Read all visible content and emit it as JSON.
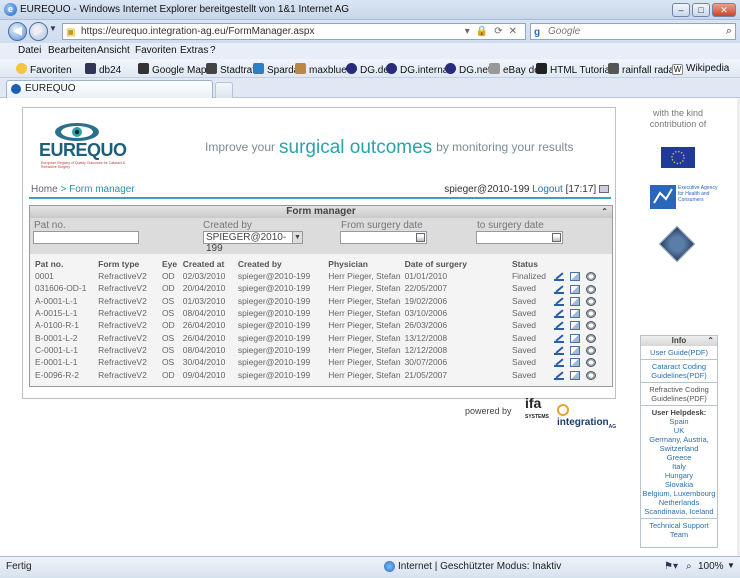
{
  "window": {
    "title": "EUREQUO - Windows Internet Explorer bereitgestellt von 1&1 Internet AG"
  },
  "address": {
    "url": "https://eurequo.integration-ag.eu/FormManager.aspx"
  },
  "search": {
    "placeholder": "Google"
  },
  "menu": [
    "Datei",
    "Bearbeiten",
    "Ansicht",
    "Favoriten",
    "Extras",
    "?"
  ],
  "favorites": {
    "label": "Favoriten",
    "items": [
      "db24",
      "Google Maps",
      "Stadtrat",
      "Sparda",
      "maxblue",
      "DG.de",
      "DG.interna",
      "DG.net",
      "eBay de",
      "HTML Tutorial",
      "rainfall radar",
      "Wikipedia"
    ]
  },
  "tab": {
    "title": "EUREQUO"
  },
  "site": {
    "logo_text": "EUREQUO",
    "logo_sub": "European Registry of Quality Outcomes for Cataract & Refractive Surgery",
    "tagline_pre": "Improve your",
    "tagline_main": "surgical outcomes",
    "tagline_post": "by monitoring your results"
  },
  "breadcrumb": {
    "home": "Home",
    "sep": ">",
    "current": "Form manager"
  },
  "user": {
    "name": "spieger@2010-199",
    "logout": "Logout",
    "time": "[17:17]"
  },
  "form_manager": {
    "title": "Form manager",
    "filters": {
      "pat_no": {
        "label": "Pat no.",
        "value": ""
      },
      "created_by": {
        "label": "Created by",
        "value": "SPIEGER@2010-199"
      },
      "from_date": {
        "label": "From surgery date",
        "value": ""
      },
      "to_date": {
        "label": "to surgery date",
        "value": ""
      }
    },
    "columns": [
      "Pat no.",
      "Form type",
      "Eye",
      "Created at",
      "Created by",
      "Physician",
      "Date of surgery",
      "Status"
    ],
    "rows": [
      [
        "0001",
        "RefractiveV2",
        "OD",
        "02/03/2010",
        "spieger@2010-199",
        "Herr Pieger, Stefan",
        "01/01/2010",
        "Finalized"
      ],
      [
        "031606-OD-1",
        "RefractiveV2",
        "OD",
        "20/04/2010",
        "spieger@2010-199",
        "Herr Pieger, Stefan",
        "22/05/2007",
        "Saved"
      ],
      [
        "A-0001-L-1",
        "RefractiveV2",
        "OS",
        "01/03/2010",
        "spieger@2010-199",
        "Herr Pieger, Stefan",
        "19/02/2006",
        "Saved"
      ],
      [
        "A-0015-L-1",
        "RefractiveV2",
        "OS",
        "08/04/2010",
        "spieger@2010-199",
        "Herr Pieger, Stefan",
        "03/10/2006",
        "Saved"
      ],
      [
        "A-0100-R-1",
        "RefractiveV2",
        "OD",
        "26/04/2010",
        "spieger@2010-199",
        "Herr Pieger, Stefan",
        "26/03/2006",
        "Saved"
      ],
      [
        "B-0001-L-2",
        "RefractiveV2",
        "OS",
        "26/04/2010",
        "spieger@2010-199",
        "Herr Pieger, Stefan",
        "13/12/2008",
        "Saved"
      ],
      [
        "C-0001-L-1",
        "RefractiveV2",
        "OS",
        "08/04/2010",
        "spieger@2010-199",
        "Herr Pieger, Stefan",
        "12/12/2008",
        "Saved"
      ],
      [
        "E-0001-L-1",
        "RefractiveV2",
        "OS",
        "30/04/2010",
        "spieger@2010-199",
        "Herr Pieger, Stefan",
        "30/07/2006",
        "Saved"
      ],
      [
        "E-0096-R-2",
        "RefractiveV2",
        "OD",
        "09/04/2010",
        "spieger@2010-199",
        "Herr Pieger, Stefan",
        "21/05/2007",
        "Saved"
      ]
    ]
  },
  "footer": {
    "powered_by": "powered by",
    "ifa": "ifa",
    "ifa_sub": "SYSTEMS",
    "integration": "integration",
    "integration_sub": "AG"
  },
  "sidebar": {
    "contribution": "with the kind contribution of",
    "agency": "Executive Agency for Health and Consumers",
    "info_title": "Info",
    "user_guide": "User Guide(PDF)",
    "cataract_guide": "Cataract Coding Guidelines(PDF)",
    "refractive_guide": "Refractive Coding Guidelines(PDF)",
    "helpdesk_title": "User Helpdesk:",
    "helpdesk": [
      "Spain",
      "UK",
      "Germany, Austria, Switzerland",
      "Greece",
      "Italy",
      "Hungary",
      "Slovakia",
      "Belgium, Luxembourg",
      "Netherlands",
      "Scandinavia, Iceland"
    ],
    "tech_support": "Technical Support Team"
  },
  "status": {
    "left": "Fertig",
    "zone": "Internet | Geschützter Modus: Inaktiv",
    "zoom": "100%"
  },
  "colors": {
    "accent": "#2aa3a8",
    "link": "#2a6fb0"
  }
}
